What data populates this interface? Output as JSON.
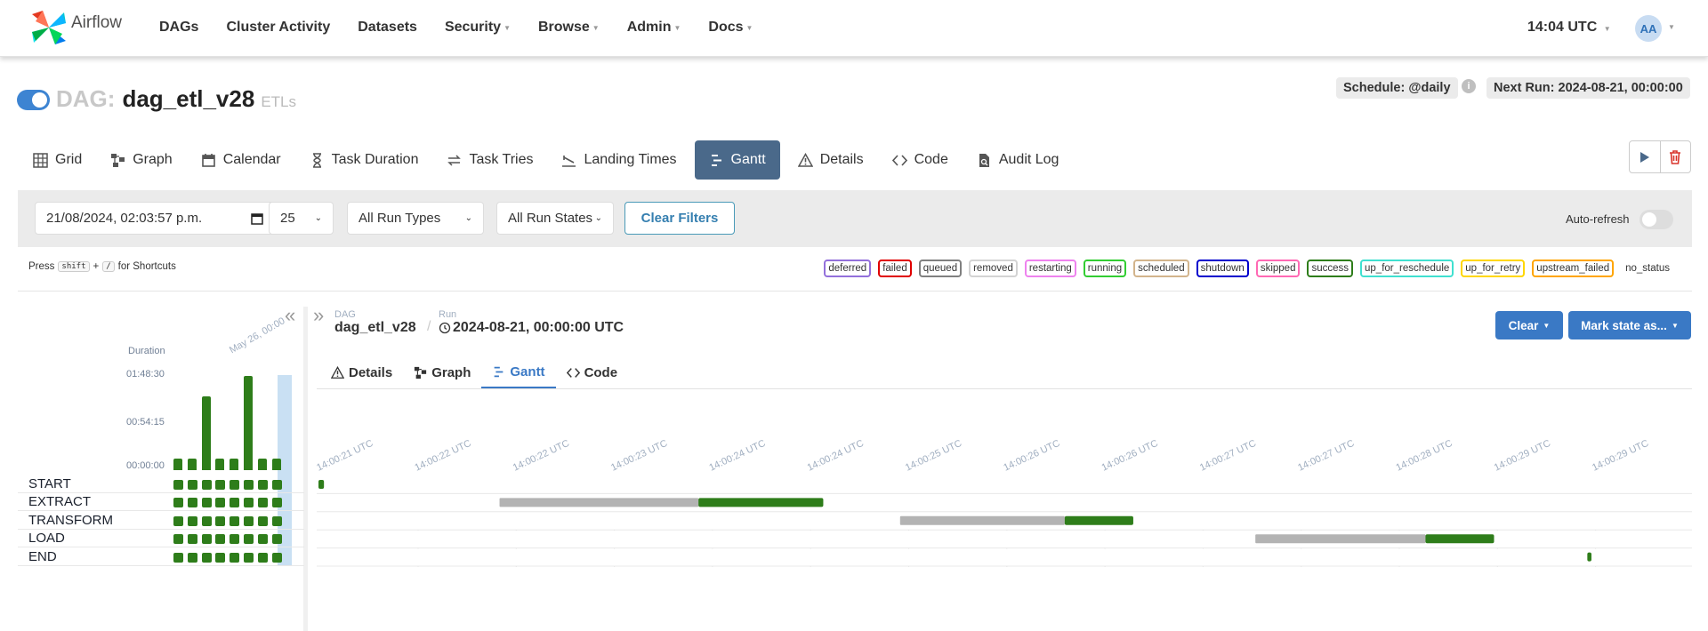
{
  "nav": {
    "brand": "Airflow",
    "items": [
      {
        "label": "DAGs",
        "dropdown": false
      },
      {
        "label": "Cluster Activity",
        "dropdown": false
      },
      {
        "label": "Datasets",
        "dropdown": false
      },
      {
        "label": "Security",
        "dropdown": true
      },
      {
        "label": "Browse",
        "dropdown": true
      },
      {
        "label": "Admin",
        "dropdown": true
      },
      {
        "label": "Docs",
        "dropdown": true
      }
    ],
    "time": "14:04 UTC",
    "avatar": "AA"
  },
  "dag": {
    "prefix": "DAG:",
    "name": "dag_etl_v28",
    "tag": "ETLs",
    "schedule": "Schedule: @daily",
    "next_run": "Next Run: 2024-08-21, 00:00:00",
    "paused": false
  },
  "tabs": [
    {
      "label": "Grid",
      "icon": "grid-icon"
    },
    {
      "label": "Graph",
      "icon": "graph-icon"
    },
    {
      "label": "Calendar",
      "icon": "calendar-icon"
    },
    {
      "label": "Task Duration",
      "icon": "hourglass-icon"
    },
    {
      "label": "Task Tries",
      "icon": "retry-icon"
    },
    {
      "label": "Landing Times",
      "icon": "landing-icon"
    },
    {
      "label": "Gantt",
      "icon": "gantt-icon",
      "active": true
    },
    {
      "label": "Details",
      "icon": "warning-icon"
    },
    {
      "label": "Code",
      "icon": "code-icon"
    },
    {
      "label": "Audit Log",
      "icon": "file-search-icon"
    }
  ],
  "filters": {
    "datetime": "21/08/2024, 02:03:57 p.m.",
    "num_runs": "25",
    "run_types": "All Run Types",
    "run_states": "All Run States",
    "clear_label": "Clear Filters",
    "autorefresh_label": "Auto-refresh",
    "autorefresh_on": false
  },
  "shortcuts": {
    "press": "Press",
    "key1": "shift",
    "plus": "+",
    "key2": "/",
    "suffix": "for Shortcuts"
  },
  "legend": [
    {
      "label": "deferred",
      "color": "#9370db"
    },
    {
      "label": "failed",
      "color": "#e00000"
    },
    {
      "label": "queued",
      "color": "#808080"
    },
    {
      "label": "removed",
      "color": "#d3d3d3"
    },
    {
      "label": "restarting",
      "color": "#ee82ee"
    },
    {
      "label": "running",
      "color": "#32cd32"
    },
    {
      "label": "scheduled",
      "color": "#d2b48c"
    },
    {
      "label": "shutdown",
      "color": "#0000cd"
    },
    {
      "label": "skipped",
      "color": "#ff69b4"
    },
    {
      "label": "success",
      "color": "#2e7d1a"
    },
    {
      "label": "up_for_reschedule",
      "color": "#40e0d0"
    },
    {
      "label": "up_for_retry",
      "color": "#ffd700"
    },
    {
      "label": "upstream_failed",
      "color": "#ffa500"
    },
    {
      "label": "no_status",
      "color": "#ffffff"
    }
  ],
  "grid": {
    "duration_label": "Duration",
    "durations": [
      "01:48:30",
      "00:54:15",
      "00:00:00"
    ],
    "date_label": "May 26, 00:00",
    "run_duration_fractions": [
      0.12,
      0.12,
      0.78,
      0.12,
      0.12,
      1.0,
      0.12,
      0.12
    ],
    "tasks": [
      "START",
      "EXTRACT",
      "TRANSFORM",
      "LOAD",
      "END"
    ],
    "run_count": 8
  },
  "detail": {
    "dag_label": "DAG",
    "dag_value": "dag_etl_v28",
    "run_label": "Run",
    "run_value": "2024-08-21, 00:00:00 UTC",
    "clear_btn": "Clear",
    "mark_btn": "Mark state as...",
    "subtabs": [
      {
        "label": "Details",
        "icon": "warning-icon"
      },
      {
        "label": "Graph",
        "icon": "graph-icon"
      },
      {
        "label": "Gantt",
        "icon": "gantt-icon",
        "active": true
      },
      {
        "label": "Code",
        "icon": "code-icon"
      }
    ]
  },
  "gantt": {
    "ticks": [
      "14:00:21 UTC",
      "14:00:22 UTC",
      "14:00:22 UTC",
      "14:00:23 UTC",
      "14:00:24 UTC",
      "14:00:24 UTC",
      "14:00:25 UTC",
      "14:00:26 UTC",
      "14:00:26 UTC",
      "14:00:27 UTC",
      "14:00:27 UTC",
      "14:00:28 UTC",
      "14:00:29 UTC",
      "14:00:29 UTC"
    ],
    "queued_color": "#b3b3b3",
    "success_color": "#2e7d1a",
    "tasks": [
      {
        "name": "START",
        "queued_start": 0.0,
        "start": 0.0,
        "end": 0.004
      },
      {
        "name": "EXTRACT",
        "queued_start": 0.132,
        "start": 0.277,
        "end": 0.368
      },
      {
        "name": "TRANSFORM",
        "queued_start": 0.424,
        "start": 0.544,
        "end": 0.594
      },
      {
        "name": "LOAD",
        "queued_start": 0.683,
        "start": 0.807,
        "end": 0.857
      },
      {
        "name": "END",
        "queued_start": 0.925,
        "start": 0.925,
        "end": 0.928
      }
    ]
  }
}
